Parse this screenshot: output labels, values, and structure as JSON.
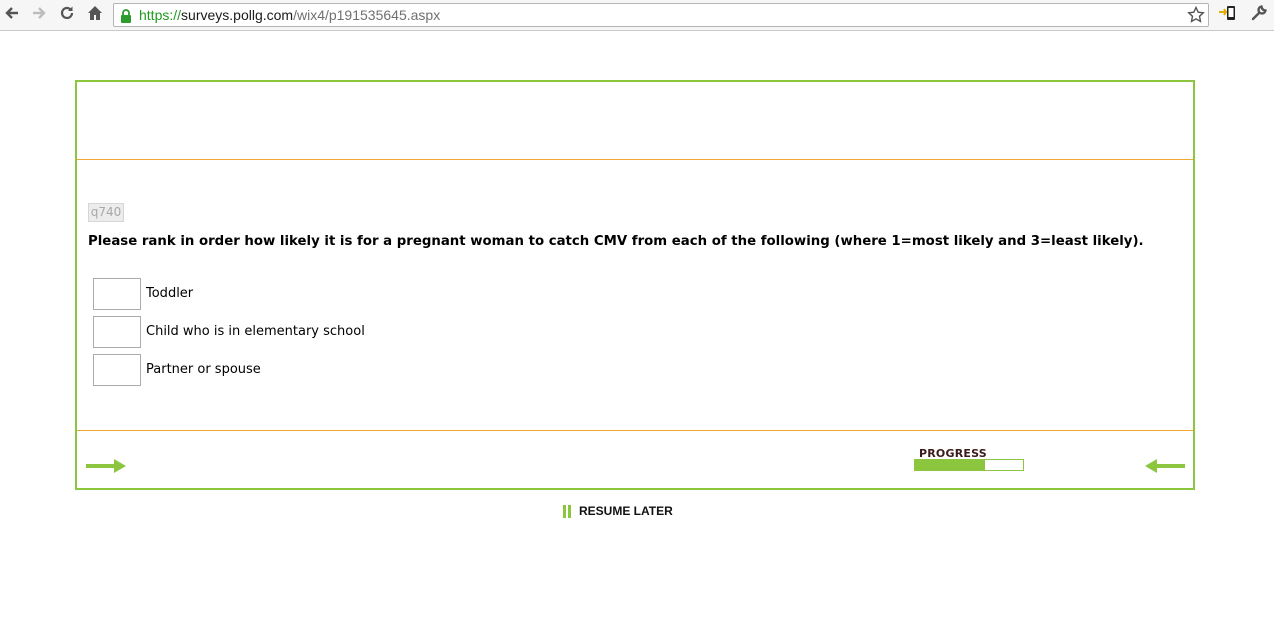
{
  "browser": {
    "url_scheme": "https://",
    "url_host": "surveys.pollg.com",
    "url_path": "/wix4/p191535645.aspx",
    "icons": [
      "back-icon",
      "forward-icon",
      "reload-icon",
      "home-icon",
      "lock-icon",
      "bookmark-star-icon",
      "extension-icon",
      "wrench-icon"
    ]
  },
  "question": {
    "id": "q740",
    "text": "Please rank in order how likely it is for a pregnant woman to catch CMV from each of the following (where 1=most likely and 3=least likely).",
    "items": [
      {
        "label": "Toddler",
        "value": ""
      },
      {
        "label": "Child who is in elementary school",
        "value": ""
      },
      {
        "label": "Partner or spouse",
        "value": ""
      }
    ]
  },
  "footer": {
    "progress_label": "PROGRESS",
    "progress_fraction": 0.65
  },
  "resume_label": "RESUME LATER",
  "colors": {
    "accent": "#8cc63e",
    "divider": "#f0a830"
  }
}
